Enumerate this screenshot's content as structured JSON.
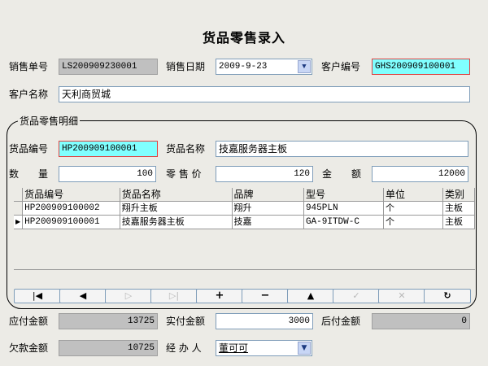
{
  "title": "货品零售录入",
  "header": {
    "sale_no_label": "销售单号",
    "sale_no": "LS200909230001",
    "sale_date_label": "销售日期",
    "sale_date": "2009-9-23",
    "customer_no_label": "客户编号",
    "customer_no": "GHS200909100001",
    "customer_name_label": "客户名称",
    "customer_name": "天利商贸城"
  },
  "detail": {
    "group_label": "货品零售明细",
    "goods_no_label": "货品编号",
    "goods_no": "HP200909100001",
    "goods_name_label": "货品名称",
    "goods_name": "技嘉服务器主板",
    "qty_label": "数　　量",
    "qty": "100",
    "price_label": "零 售 价",
    "price": "120",
    "amount_label": "金　　额",
    "amount": "12000"
  },
  "grid": {
    "columns": [
      "货品编号",
      "货品名称",
      "品牌",
      "型号",
      "单位",
      "类别"
    ],
    "rows": [
      {
        "indicator": "",
        "cells": [
          "HP200909100002",
          "翔升主板",
          "翔升",
          "945PLN",
          "个",
          "主板"
        ]
      },
      {
        "indicator": "▶",
        "cells": [
          "HP200909100001",
          "技嘉服务器主板",
          "技嘉",
          "GA-9ITDW-C",
          "个",
          "主板"
        ]
      }
    ]
  },
  "nav": [
    {
      "name": "first-record-button",
      "glyph": "|◀",
      "enabled": true
    },
    {
      "name": "prior-record-button",
      "glyph": "◀",
      "enabled": true
    },
    {
      "name": "next-record-button",
      "glyph": "▷",
      "enabled": false
    },
    {
      "name": "last-record-button",
      "glyph": "▷|",
      "enabled": false
    },
    {
      "name": "insert-record-button",
      "glyph": "+",
      "enabled": true
    },
    {
      "name": "delete-record-button",
      "glyph": "−",
      "enabled": true
    },
    {
      "name": "edit-record-button",
      "glyph": "▲",
      "enabled": true
    },
    {
      "name": "post-record-button",
      "glyph": "✓",
      "enabled": false
    },
    {
      "name": "cancel-record-button",
      "glyph": "✕",
      "enabled": false
    },
    {
      "name": "refresh-button",
      "glyph": "↻",
      "enabled": true
    }
  ],
  "footer": {
    "payable_label": "应付金额",
    "payable": "13725",
    "paid_label": "实付金额",
    "paid": "3000",
    "postpay_label": "后付金额",
    "postpay": "0",
    "owed_label": "欠款金额",
    "owed": "10725",
    "handler_label": "经 办 人",
    "handler": "董可可"
  }
}
